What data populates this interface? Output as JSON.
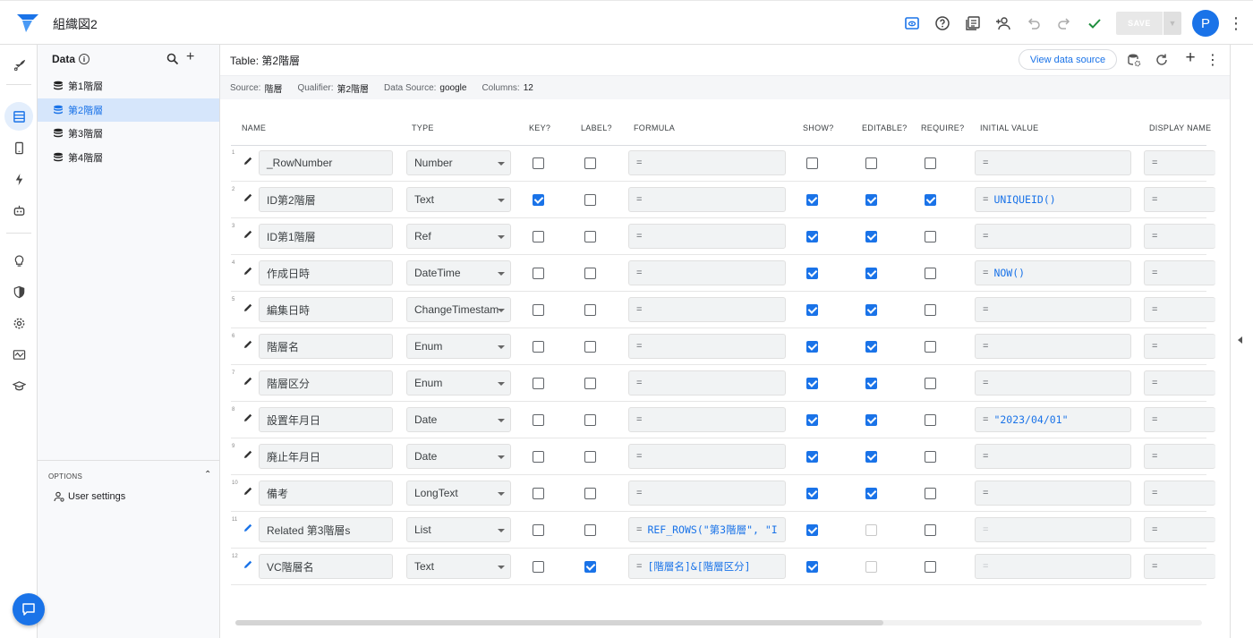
{
  "app": {
    "title": "組織図2"
  },
  "topbar": {
    "save_label": "SAVE",
    "avatar_letter": "P"
  },
  "data_panel": {
    "heading": "Data",
    "tables": [
      "第1階層",
      "第2階層",
      "第3階層",
      "第4階層"
    ],
    "selected_index": 1,
    "options_label": "OPTIONS",
    "user_settings_label": "User settings"
  },
  "main": {
    "table_title": "Table: 第2階層",
    "view_source_label": "View data source",
    "info": [
      {
        "key": "Source:",
        "value": "階層"
      },
      {
        "key": "Qualifier:",
        "value": "第2階層"
      },
      {
        "key": "Data Source:",
        "value": "google"
      },
      {
        "key": "Columns:",
        "value": "12"
      }
    ],
    "columns": [
      "NAME",
      "TYPE",
      "KEY?",
      "LABEL?",
      "FORMULA",
      "SHOW?",
      "EDITABLE?",
      "REQUIRE?",
      "INITIAL VALUE",
      "DISPLAY NAME"
    ],
    "rows": [
      {
        "num": "1",
        "name": "_RowNumber",
        "type": "Number",
        "key": false,
        "label": false,
        "formula": "",
        "show": false,
        "editable": false,
        "require": false,
        "initial": "",
        "display": "",
        "virtual": false
      },
      {
        "num": "2",
        "name": "ID第2階層",
        "type": "Text",
        "key": true,
        "label": false,
        "formula": "",
        "show": true,
        "editable": true,
        "require": true,
        "initial": "UNIQUEID()",
        "display": "",
        "virtual": false
      },
      {
        "num": "3",
        "name": "ID第1階層",
        "type": "Ref",
        "key": false,
        "label": false,
        "formula": "",
        "show": true,
        "editable": true,
        "require": false,
        "initial": "",
        "display": "",
        "virtual": false
      },
      {
        "num": "4",
        "name": "作成日時",
        "type": "DateTime",
        "key": false,
        "label": false,
        "formula": "",
        "show": true,
        "editable": true,
        "require": false,
        "initial": "NOW()",
        "display": "",
        "virtual": false
      },
      {
        "num": "5",
        "name": "編集日時",
        "type": "ChangeTimestam",
        "key": false,
        "label": false,
        "formula": "",
        "show": true,
        "editable": true,
        "require": false,
        "initial": "",
        "display": "",
        "virtual": false
      },
      {
        "num": "6",
        "name": "階層名",
        "type": "Enum",
        "key": false,
        "label": false,
        "formula": "",
        "show": true,
        "editable": true,
        "require": false,
        "initial": "",
        "display": "",
        "virtual": false
      },
      {
        "num": "7",
        "name": "階層区分",
        "type": "Enum",
        "key": false,
        "label": false,
        "formula": "",
        "show": true,
        "editable": true,
        "require": false,
        "initial": "",
        "display": "",
        "virtual": false
      },
      {
        "num": "8",
        "name": "設置年月日",
        "type": "Date",
        "key": false,
        "label": false,
        "formula": "",
        "show": true,
        "editable": true,
        "require": false,
        "initial": "\"2023/04/01\"",
        "display": "",
        "virtual": false
      },
      {
        "num": "9",
        "name": "廃止年月日",
        "type": "Date",
        "key": false,
        "label": false,
        "formula": "",
        "show": true,
        "editable": true,
        "require": false,
        "initial": "",
        "display": "",
        "virtual": false
      },
      {
        "num": "10",
        "name": "備考",
        "type": "LongText",
        "key": false,
        "label": false,
        "formula": "",
        "show": true,
        "editable": true,
        "require": false,
        "initial": "",
        "display": "",
        "virtual": false
      },
      {
        "num": "11",
        "name": "Related 第3階層s",
        "type": "List",
        "key": false,
        "label": false,
        "formula": "REF_ROWS(\"第3階層\", \"I",
        "show": true,
        "editable": false,
        "require": false,
        "initial": "",
        "display": "",
        "virtual": true
      },
      {
        "num": "12",
        "name": "VC階層名",
        "type": "Text",
        "key": false,
        "label": true,
        "formula": "[階層名]&[階層区分]",
        "show": true,
        "editable": false,
        "require": false,
        "initial": "",
        "display": "",
        "virtual": true
      }
    ]
  },
  "colors": {
    "accent": "#1a73e8",
    "selected_bg": "#d6e6fb",
    "panel_bg": "#f8f9fb"
  },
  "scroll": {
    "horizontal_thumb_fraction": 0.67
  }
}
